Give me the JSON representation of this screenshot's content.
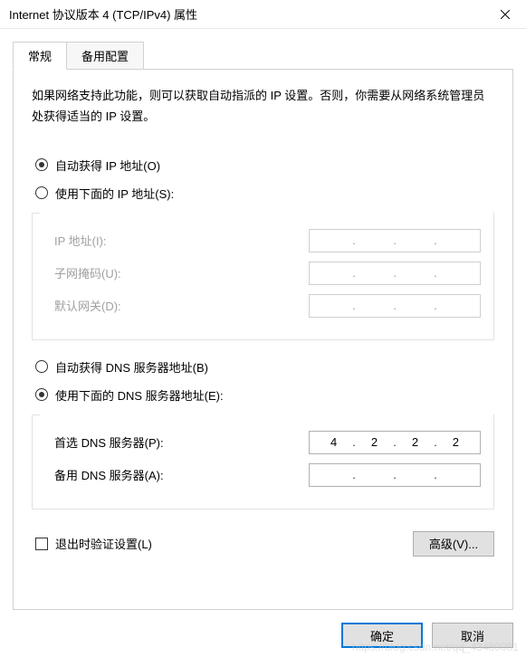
{
  "window": {
    "title": "Internet 协议版本 4 (TCP/IPv4) 属性"
  },
  "tabs": {
    "general": "常规",
    "alternate": "备用配置"
  },
  "description": "如果网络支持此功能，则可以获取自动指派的 IP 设置。否则，你需要从网络系统管理员处获得适当的 IP 设置。",
  "ip_section": {
    "auto_label": "自动获得 IP 地址(O)",
    "manual_label": "使用下面的 IP 地址(S):",
    "auto_selected": true,
    "fields": {
      "ip_label": "IP 地址(I):",
      "subnet_label": "子网掩码(U):",
      "gateway_label": "默认网关(D):",
      "ip_value": [
        "",
        "",
        "",
        ""
      ],
      "subnet_value": [
        "",
        "",
        "",
        ""
      ],
      "gateway_value": [
        "",
        "",
        "",
        ""
      ]
    }
  },
  "dns_section": {
    "auto_label": "自动获得 DNS 服务器地址(B)",
    "manual_label": "使用下面的 DNS 服务器地址(E):",
    "manual_selected": true,
    "fields": {
      "preferred_label": "首选 DNS 服务器(P):",
      "alternate_label": "备用 DNS 服务器(A):",
      "preferred_value": [
        "4",
        "2",
        "2",
        "2"
      ],
      "alternate_value": [
        "",
        "",
        "",
        ""
      ]
    }
  },
  "validate_checkbox": {
    "label": "退出时验证设置(L)",
    "checked": false
  },
  "buttons": {
    "advanced": "高级(V)...",
    "ok": "确定",
    "cancel": "取消"
  },
  "watermark": "https://blog.csdn.net/qq_43480081"
}
